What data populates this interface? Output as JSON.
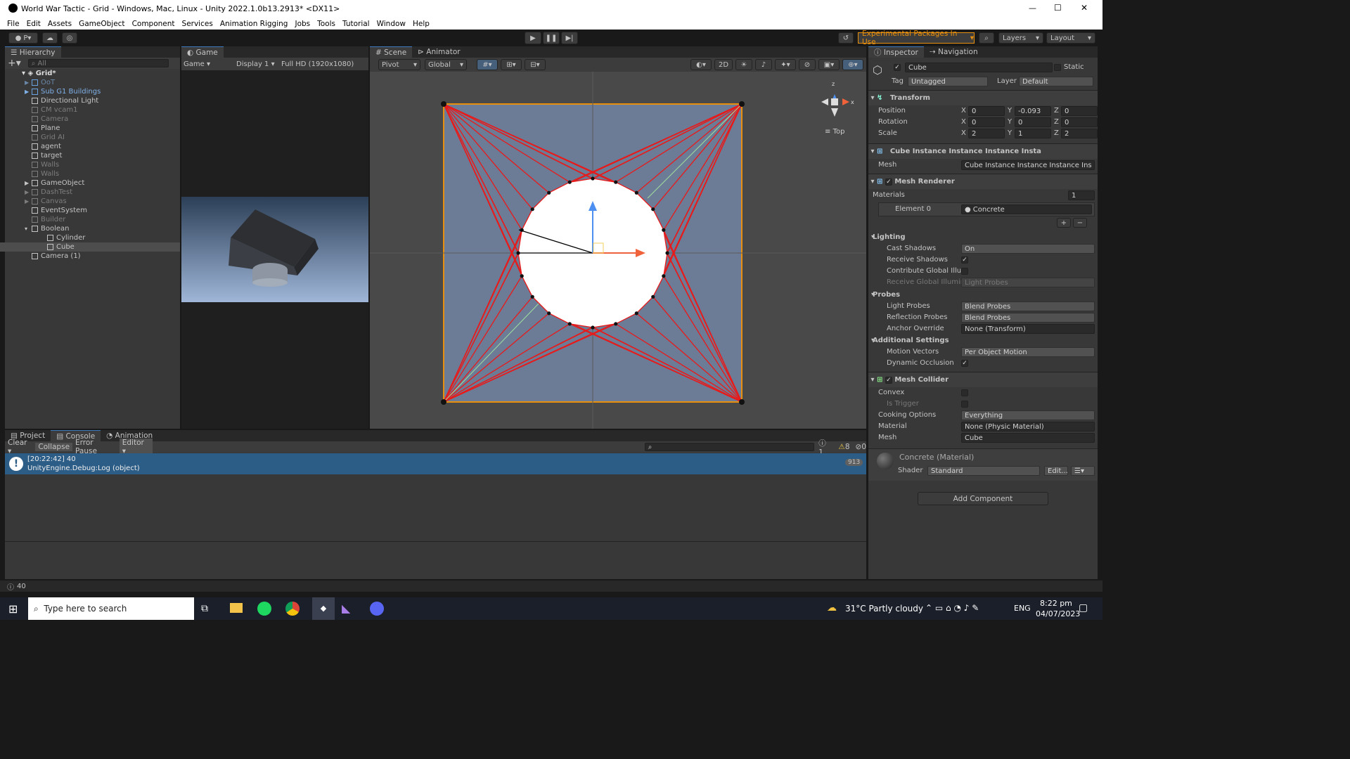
{
  "window": {
    "title": "World War Tactic - Grid - Windows, Mac, Linux - Unity 2022.1.0b13.2913* <DX11>",
    "minimize": "—",
    "maximize": "☐",
    "close": "✕"
  },
  "menu": [
    "File",
    "Edit",
    "Assets",
    "GameObject",
    "Component",
    "Services",
    "Animation Rigging",
    "Jobs",
    "Tools",
    "Tutorial",
    "Window",
    "Help"
  ],
  "toolbar": {
    "account": "P",
    "experimental": "Experimental Packages In Use",
    "layers": "Layers",
    "layout": "Layout"
  },
  "hierarchy": {
    "tab": "Hierarchy",
    "search_placeholder": "All",
    "scene": "Grid*",
    "items": [
      {
        "label": "OoT",
        "dim": true,
        "indent": 1,
        "arrow": true,
        "blue": true
      },
      {
        "label": "Sub G1 Buildings",
        "dim": false,
        "indent": 1,
        "arrow": true,
        "blue": true
      },
      {
        "label": "Directional Light",
        "dim": false,
        "indent": 1
      },
      {
        "label": "CM vcam1",
        "dim": true,
        "indent": 1
      },
      {
        "label": "Camera",
        "dim": true,
        "indent": 1
      },
      {
        "label": "Plane",
        "dim": false,
        "indent": 1
      },
      {
        "label": "Grid AI",
        "dim": true,
        "indent": 1
      },
      {
        "label": "agent",
        "dim": false,
        "indent": 1
      },
      {
        "label": "target",
        "dim": false,
        "indent": 1
      },
      {
        "label": "Walls",
        "dim": true,
        "indent": 1
      },
      {
        "label": "Walls",
        "dim": true,
        "indent": 1
      },
      {
        "label": "GameObject",
        "dim": false,
        "indent": 1,
        "arrow": true
      },
      {
        "label": "DashTest",
        "dim": true,
        "indent": 1,
        "arrow": true
      },
      {
        "label": "Canvas",
        "dim": true,
        "indent": 1,
        "arrow": true
      },
      {
        "label": "EventSystem",
        "dim": false,
        "indent": 1
      },
      {
        "label": "Builder",
        "dim": true,
        "indent": 1
      },
      {
        "label": "Boolean",
        "dim": false,
        "indent": 1,
        "open": true
      },
      {
        "label": "Cylinder",
        "dim": false,
        "indent": 2
      },
      {
        "label": "Cube",
        "dim": false,
        "indent": 2,
        "selected": true
      },
      {
        "label": "Camera (1)",
        "dim": false,
        "indent": 1
      }
    ]
  },
  "game": {
    "tab": "Game",
    "mode": "Game",
    "display": "Display 1",
    "resolution": "Full HD (1920x1080)"
  },
  "scene": {
    "tab": "Scene",
    "animator_tab": "Animator",
    "pivot": "Pivot",
    "global": "Global",
    "btn2d": "2D",
    "gizmo_label": "Top",
    "axis_x": "x",
    "axis_z": "z"
  },
  "inspector": {
    "tab": "Inspector",
    "nav_tab": "Navigation",
    "name": "Cube",
    "static": "Static",
    "tag_label": "Tag",
    "tag": "Untagged",
    "layer_label": "Layer",
    "layer": "Default",
    "transform": {
      "title": "Transform",
      "position": "Position",
      "rotation": "Rotation",
      "scale": "Scale",
      "pos": [
        "0",
        "-0.093",
        "0"
      ],
      "rot": [
        "0",
        "0",
        "0"
      ],
      "scl": [
        "2",
        "1",
        "2"
      ]
    },
    "meshfilter": {
      "title": "Cube Instance Instance Instance Insta",
      "mesh_label": "Mesh",
      "mesh": "Cube Instance Instance Instance Ins"
    },
    "renderer": {
      "title": "Mesh Renderer",
      "materials": "Materials",
      "count": "1",
      "element": "Element 0",
      "material": "Concrete",
      "lighting": "Lighting",
      "cast_shadows": "Cast Shadows",
      "cast_val": "On",
      "receive_shadows": "Receive Shadows",
      "contrib_gi": "Contribute Global Illum",
      "receive_gi": "Receive Global Illumin",
      "receive_gi_val": "Light Probes",
      "probes": "Probes",
      "light_probes": "Light Probes",
      "light_val": "Blend Probes",
      "refl_probes": "Reflection Probes",
      "refl_val": "Blend Probes",
      "anchor": "Anchor Override",
      "anchor_val": "None (Transform)",
      "additional": "Additional Settings",
      "motion": "Motion Vectors",
      "motion_val": "Per Object Motion",
      "dynamic": "Dynamic Occlusion"
    },
    "collider": {
      "title": "Mesh Collider",
      "convex": "Convex",
      "trigger": "Is Trigger",
      "cooking": "Cooking Options",
      "cooking_val": "Everything",
      "material": "Material",
      "material_val": "None (Physic Material)",
      "mesh": "Mesh",
      "mesh_val": "Cube"
    },
    "matblock": {
      "title": "Concrete (Material)",
      "shader_label": "Shader",
      "shader": "Standard",
      "edit": "Edit..."
    },
    "add_component": "Add Component"
  },
  "console": {
    "tabs": [
      "Project",
      "Console",
      "Animation"
    ],
    "clear": "Clear",
    "collapse": "Collapse",
    "error_pause": "Error Pause",
    "editor": "Editor",
    "count_info": "1",
    "count_warn": "8",
    "count_err": "0",
    "entry_line1": "[20:22:42] 40",
    "entry_line2": "UnityEngine.Debug:Log (object)",
    "entry_count": "913"
  },
  "statusbar": {
    "msg": "40"
  },
  "taskbar": {
    "search": "Type here to search",
    "weather": "31°C  Partly cloudy",
    "lang": "ENG",
    "time": "8:22 pm",
    "date": "04/07/2023"
  }
}
